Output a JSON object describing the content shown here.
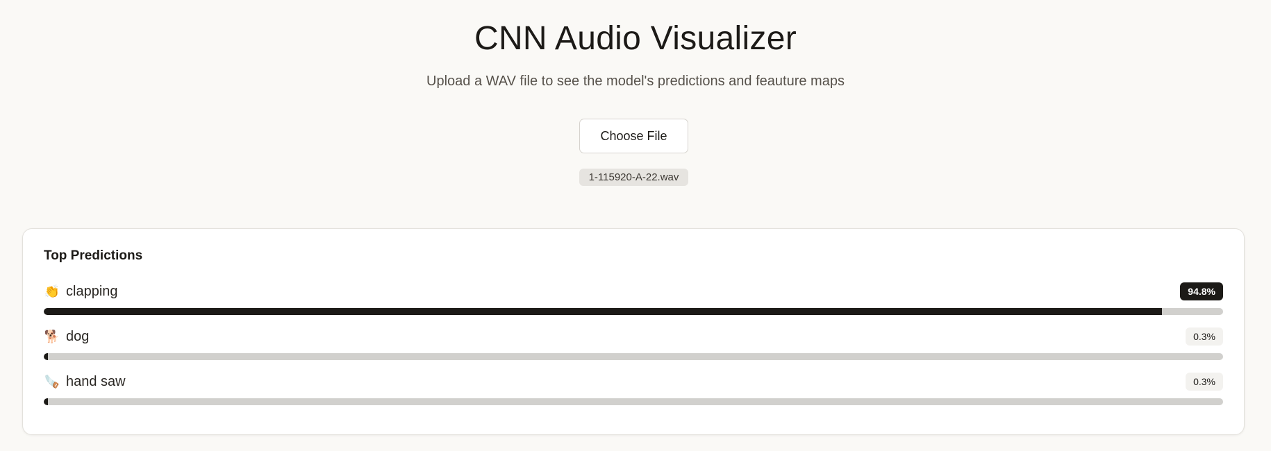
{
  "header": {
    "title": "CNN Audio Visualizer",
    "subtitle": "Upload a WAV file to see the model's predictions and feauture maps"
  },
  "upload": {
    "button_label": "Choose File",
    "file_name": "1-115920-A-22.wav"
  },
  "predictions": {
    "title": "Top Predictions",
    "items": [
      {
        "icon": "clapping-hands-icon",
        "glyph": "👏",
        "label": "clapping",
        "percent_text": "94.8%",
        "value": 0.948,
        "badge_color": "#1c1a17"
      },
      {
        "icon": "dog-icon",
        "glyph": "🐕",
        "label": "dog",
        "percent_text": "0.3%",
        "value": 0.003,
        "badge_color": "#f3f2ef"
      },
      {
        "icon": "saw-icon",
        "glyph": "🪚",
        "label": "hand saw",
        "percent_text": "0.3%",
        "value": 0.003,
        "badge_color": "#f3f2ef"
      }
    ]
  },
  "colors": {
    "background": "#faf9f6",
    "bar_fill": "#1c1a17",
    "bar_track": "#d1d0cd"
  }
}
